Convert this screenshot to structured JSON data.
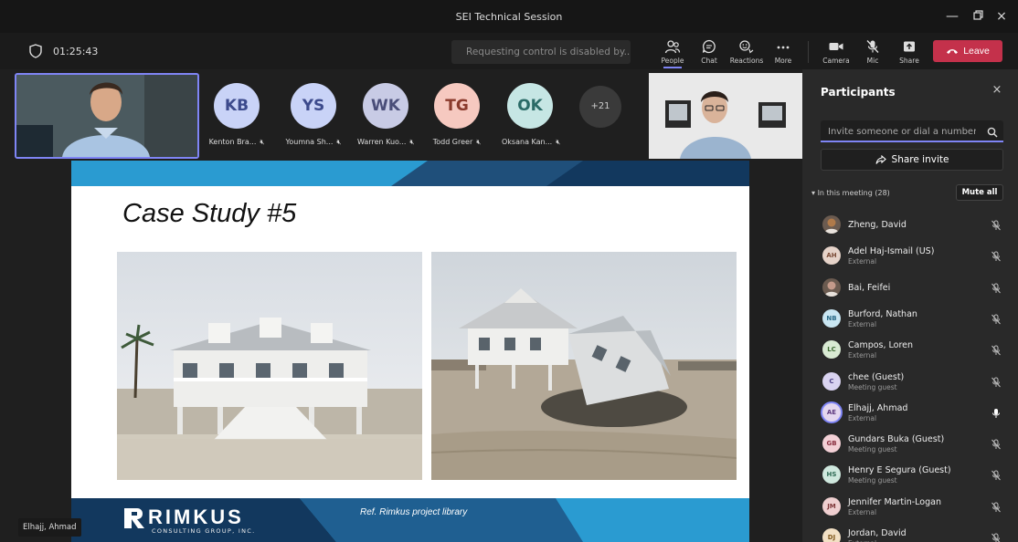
{
  "window": {
    "title": "SEI Technical Session"
  },
  "toolbar": {
    "timer": "01:25:43",
    "request_control": "Requesting control is disabled by...",
    "people_label": "People",
    "chat_label": "Chat",
    "reactions_label": "Reactions",
    "more_label": "More",
    "camera_label": "Camera",
    "mic_label": "Mic",
    "share_label": "Share",
    "leave_label": "Leave"
  },
  "stage": {
    "tiles": [
      {
        "initials": "KB",
        "name": "Kenton Bra...",
        "color": "#c9d3f7",
        "text": "#3c4a8c"
      },
      {
        "initials": "YS",
        "name": "Youmna Sh...",
        "color": "#c9d3f7",
        "text": "#3c4a8c"
      },
      {
        "initials": "WK",
        "name": "Warren Kuo...",
        "color": "#c8cbe5",
        "text": "#4a4e79"
      },
      {
        "initials": "TG",
        "name": "Todd Greer",
        "color": "#f6c9c0",
        "text": "#8a3a2c"
      },
      {
        "initials": "OK",
        "name": "Oksana Kan...",
        "color": "#c6e6e4",
        "text": "#2a6b67"
      }
    ],
    "more_count": "+21",
    "self_name": "Elhajj, Ahmad"
  },
  "slide": {
    "title": "Case Study #5",
    "logo_main": "RIMKUS",
    "logo_sub": "CONSULTING GROUP, INC.",
    "reference": "Ref. Rimkus project library"
  },
  "panel": {
    "title": "Participants",
    "invite_placeholder": "Invite someone or dial a number",
    "share_invite": "Share invite",
    "in_meeting": "In this meeting (28)",
    "mute_all": "Mute all",
    "participants": [
      {
        "name": "Zheng, David",
        "sub": "",
        "initials": "",
        "color": "#b07a4a",
        "photo": true,
        "active": false
      },
      {
        "name": "Adel Haj-Ismail (US)",
        "sub": "External",
        "initials": "AH",
        "color": "#e6d3c9",
        "text": "#7a4a35",
        "photo": false,
        "active": false
      },
      {
        "name": "Bai, Feifei",
        "sub": "",
        "initials": "",
        "color": "#c49a8a",
        "photo": true,
        "active": false
      },
      {
        "name": "Burford, Nathan",
        "sub": "External",
        "initials": "NB",
        "color": "#c9e6f2",
        "text": "#2a6a87",
        "photo": false,
        "active": false
      },
      {
        "name": "Campos, Loren",
        "sub": "External",
        "initials": "LC",
        "color": "#d9ead3",
        "text": "#3d6b32",
        "photo": false,
        "active": false
      },
      {
        "name": "chee (Guest)",
        "sub": "Meeting guest",
        "initials": "C",
        "color": "#d9d3f0",
        "text": "#4b3f85",
        "photo": false,
        "active": false
      },
      {
        "name": "Elhajj, Ahmad",
        "sub": "External",
        "initials": "AE",
        "color": "#e4d7ef",
        "text": "#5d3a7e",
        "photo": false,
        "active": true
      },
      {
        "name": "Gundars Buka (Guest)",
        "sub": "Meeting guest",
        "initials": "GB",
        "color": "#f3d0d6",
        "text": "#8a2f40",
        "photo": false,
        "active": false
      },
      {
        "name": "Henry E Segura (Guest)",
        "sub": "Meeting guest",
        "initials": "HS",
        "color": "#cfe8de",
        "text": "#2f6b55",
        "photo": false,
        "active": false
      },
      {
        "name": "Jennifer Martin-Logan",
        "sub": "External",
        "initials": "JM",
        "color": "#efcfd0",
        "text": "#7e3638",
        "photo": false,
        "active": false
      },
      {
        "name": "Jordan, David",
        "sub": "External",
        "initials": "DJ",
        "color": "#f2e0c4",
        "text": "#80591e",
        "photo": false,
        "active": false
      }
    ]
  },
  "colors": {
    "accent": "#7f85f5",
    "leave": "#c4314b",
    "slide_bar": "#2a9bd1"
  }
}
